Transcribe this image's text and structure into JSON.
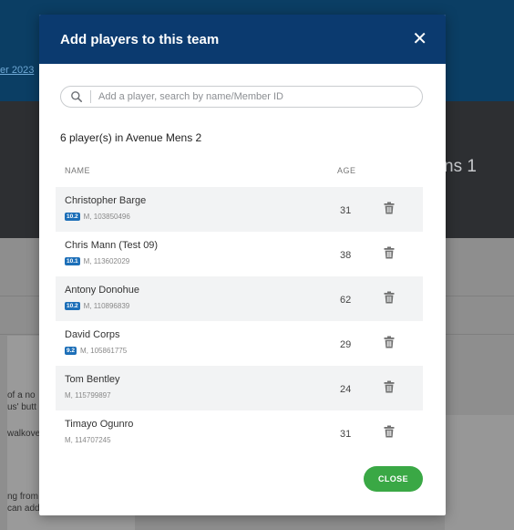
{
  "background": {
    "date_link": "er 2023",
    "team_title": "ns 1",
    "side_texts": [
      "of a no",
      "us' butt",
      "walkove",
      "ng from",
      "can add"
    ]
  },
  "modal": {
    "title": "Add players to this team",
    "close_symbol": "✕",
    "search_placeholder": "Add a player, search by name/Member ID",
    "count_text": "6 player(s) in Avenue Mens 2",
    "columns": {
      "name": "NAME",
      "age": "AGE"
    },
    "players": [
      {
        "name": "Christopher Barge",
        "badge": "10.2",
        "meta": "M, 103850496",
        "age": "31"
      },
      {
        "name": "Chris Mann (Test 09)",
        "badge": "10.1",
        "meta": "M, 113602029",
        "age": "38"
      },
      {
        "name": "Antony Donohue",
        "badge": "10.2",
        "meta": "M, 110896839",
        "age": "62"
      },
      {
        "name": "David Corps",
        "badge": "9.2",
        "meta": "M, 105861775",
        "age": "29"
      },
      {
        "name": "Tom Bentley",
        "badge": "",
        "meta": "M, 115799897",
        "age": "24"
      },
      {
        "name": "Timayo Ogunro",
        "badge": "",
        "meta": "M, 114707245",
        "age": "31"
      }
    ],
    "close_button": "CLOSE"
  },
  "icons": {
    "search": "search-icon",
    "delete": "trash-icon",
    "close": "close-icon"
  },
  "colors": {
    "header": "#0b3a6f",
    "accent_green": "#3aa845",
    "badge_blue": "#1d6fb8"
  }
}
